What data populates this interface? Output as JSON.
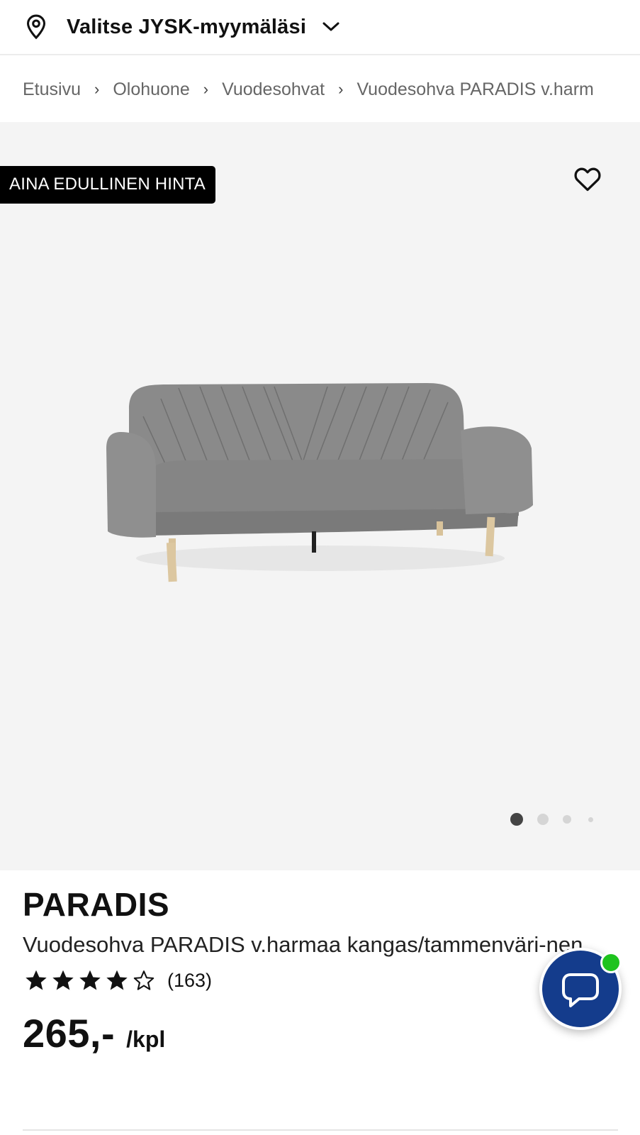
{
  "store_bar": {
    "label": "Valitse JYSK-myymälä‌si",
    "icon": "location-pin-icon",
    "chevron": "chevron-down-icon"
  },
  "breadcrumb": {
    "items": [
      "Etusivu",
      "Olohuone",
      "Vuodesohvat",
      "Vuodesohva PARADIS v.harm"
    ],
    "separator": "›"
  },
  "gallery": {
    "badge": "AINA EDULLINEN HINTA",
    "favorite_icon": "heart-outline-icon",
    "image": "sofa-product-image",
    "slides": 4,
    "active_slide": 1
  },
  "product": {
    "brand": "PARADIS",
    "description": "Vuodesohva PARADIS v.harmaa kangas/tammenväri-nen",
    "rating": 4,
    "rating_max": 5,
    "reviews": "(163)",
    "price": "265,-",
    "unit": "/kpl"
  },
  "chat": {
    "icon": "chat-bubble-icon",
    "status": "online"
  },
  "colors": {
    "badge_bg": "#000000",
    "chat_bg": "#143c8c",
    "online": "#1ec31e",
    "gallery_bg": "#f4f4f4"
  }
}
